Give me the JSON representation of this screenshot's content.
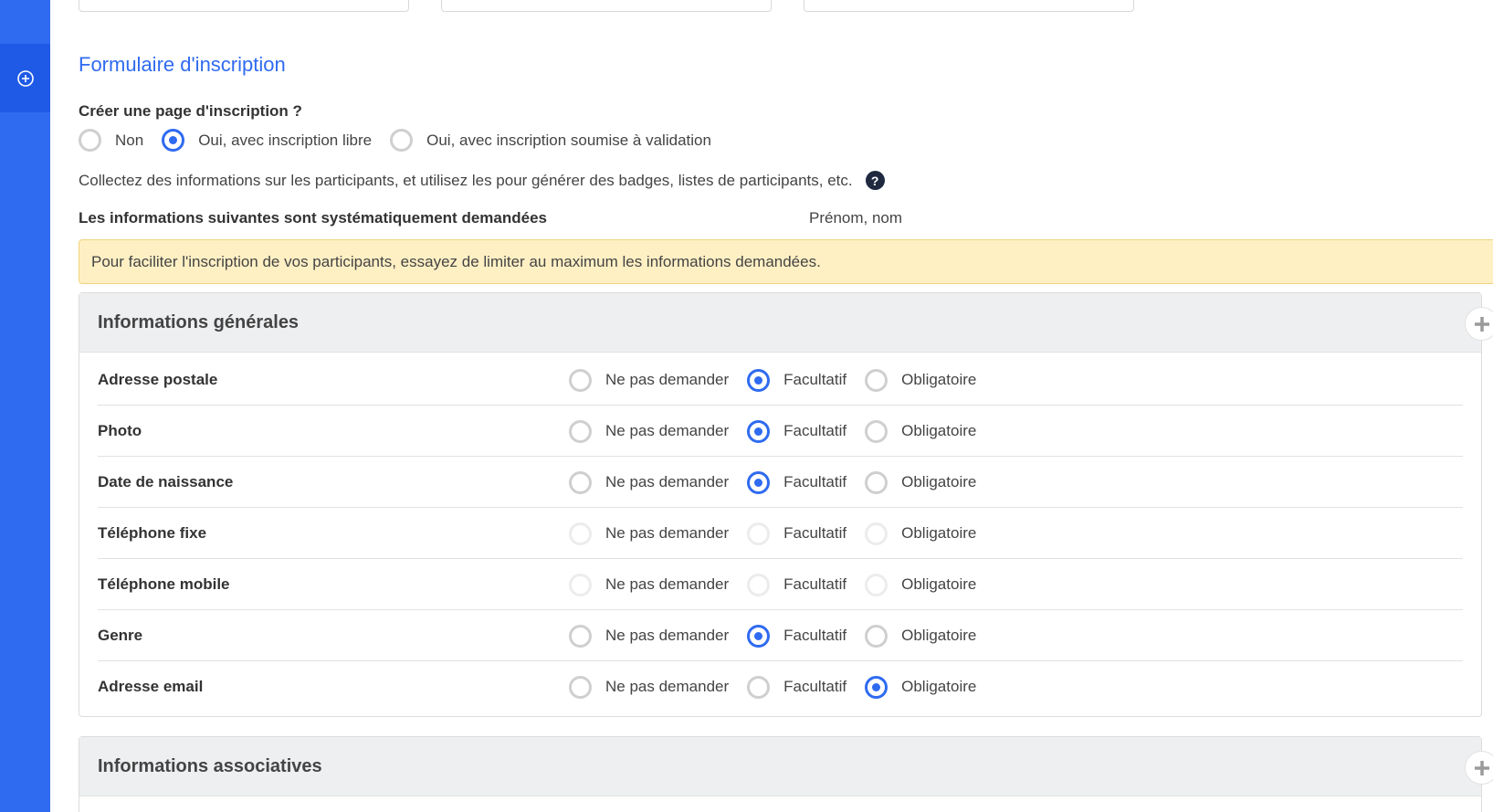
{
  "sidebar": {
    "active_icon": "add-circle-icon"
  },
  "form": {
    "title": "Formulaire d'inscription",
    "question": "Créer une page d'inscription ?",
    "page_options": [
      {
        "label": "Non",
        "checked": false
      },
      {
        "label": "Oui, avec inscription libre",
        "checked": true
      },
      {
        "label": "Oui, avec inscription soumise à validation",
        "checked": false
      }
    ],
    "help_text": "Collectez des informations sur les participants, et utilisez les pour générer des badges, listes de participants, etc.",
    "help_icon": "?",
    "system_label": "Les informations suivantes sont systématiquement demandées",
    "system_value": "Prénom, nom",
    "alert_text": "Pour faciliter l'inscription de vos participants, essayez de limiter au maximum les informations demandées."
  },
  "option_labels": [
    "Ne pas demander",
    "Facultatif",
    "Obligatoire"
  ],
  "panels": [
    {
      "title": "Informations générales",
      "rows": [
        {
          "label": "Adresse postale",
          "selected": 1,
          "enabled": true
        },
        {
          "label": "Photo",
          "selected": 1,
          "enabled": true
        },
        {
          "label": "Date de naissance",
          "selected": 1,
          "enabled": true
        },
        {
          "label": "Téléphone fixe",
          "selected": -1,
          "enabled": false
        },
        {
          "label": "Téléphone mobile",
          "selected": -1,
          "enabled": false
        },
        {
          "label": "Genre",
          "selected": 1,
          "enabled": true
        },
        {
          "label": "Adresse email",
          "selected": 2,
          "enabled": true
        }
      ]
    },
    {
      "title": "Informations associatives",
      "rows": []
    }
  ],
  "colors": {
    "accent": "#2f6bf0",
    "alert_bg": "#fff0c4"
  }
}
